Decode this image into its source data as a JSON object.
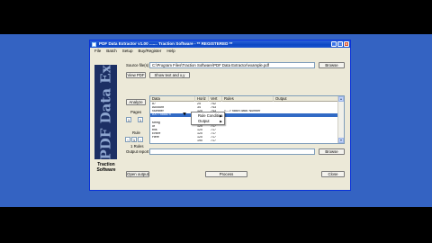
{
  "window": {
    "title": "PDF Data Extractor v1.00 ....... Traction Software - ** REGISTERED **",
    "controls": [
      "_",
      "□",
      "x"
    ]
  },
  "menubar": {
    "items": [
      "File",
      "Batch",
      "Setup",
      "Buy/Register",
      "Help"
    ]
  },
  "sidebar": {
    "logo_text": "PDF Data Extractor",
    "company": "Traction\nSoftware"
  },
  "source": {
    "label": "Source file(s)",
    "value": "C:\\Program Files\\Traction Software\\PDF Data Extractor\\example.pdf",
    "browse_label": "Browse"
  },
  "view_pdf_label": "View PDF",
  "show_text_label": "Show text and x,y",
  "analyze_label": "Analyze",
  "pages": {
    "label": "Pages",
    "from": "1",
    "to": "1"
  },
  "rule": {
    "label": "Rule",
    "value": "1",
    "count_text": "1 Rules"
  },
  "grid": {
    "columns": [
      "Data",
      "Horiz",
      "Vert",
      "Rules",
      "Output"
    ],
    "rows": [
      {
        "data": "#7",
        "horiz": "25",
        "vert": "742",
        "rules": "",
        "output": "",
        "selected": false
      },
      {
        "data": "Account",
        "horiz": "34",
        "vert": "743",
        "rules": "",
        "output": "",
        "selected": false
      },
      {
        "data": "Number",
        "horiz": "120",
        "vert": "743",
        "rules": "<---> hatch data: Number",
        "output": "",
        "selected": false
      },
      {
        "data": "AX77588879",
        "horiz": "120",
        "vert": "713",
        "rules": "",
        "output": "",
        "selected": true
      },
      {
        "data": "",
        "horiz": "201",
        "vert": "717",
        "rules": "",
        "output": "",
        "selected": false
      },
      {
        "data": "string",
        "horiz": "120",
        "vert": "717",
        "rules": "",
        "output": "",
        "selected": false
      },
      {
        "data": "of",
        "horiz": "120",
        "vert": "717",
        "rules": "",
        "output": "",
        "selected": false
      },
      {
        "data": "this",
        "horiz": "120",
        "vert": "717",
        "rules": "",
        "output": "",
        "selected": false
      },
      {
        "data": "Entire",
        "horiz": "120",
        "vert": "717",
        "rules": "",
        "output": "",
        "selected": false
      },
      {
        "data": "Here",
        "horiz": "120",
        "vert": "717",
        "rules": "",
        "output": "",
        "selected": false
      },
      {
        "data": "",
        "horiz": "190",
        "vert": "717",
        "rules": "",
        "output": "",
        "selected": false
      }
    ]
  },
  "context_menu": {
    "items": [
      "Rule Condition",
      "Output"
    ]
  },
  "output": {
    "label": "Output report",
    "value": "",
    "browse_label": "Browse"
  },
  "bottom": {
    "open_output": "Open output",
    "process": "Process",
    "close": "Close"
  }
}
